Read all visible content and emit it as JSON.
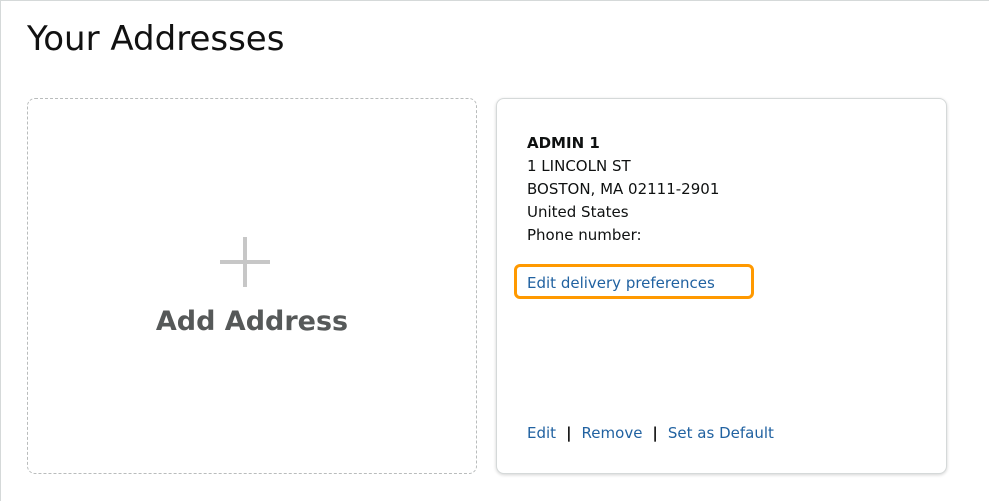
{
  "page": {
    "title": "Your Addresses"
  },
  "add_card": {
    "label": "Add Address",
    "icon": "plus-icon"
  },
  "address": {
    "name": "ADMIN 1",
    "street": "1 LINCOLN ST",
    "city_state_zip": "BOSTON, MA 02111-2901",
    "country": "United States",
    "phone_label": "Phone number:",
    "delivery_preferences_link": "Edit delivery preferences",
    "actions": {
      "edit": "Edit",
      "remove": "Remove",
      "set_default": "Set as Default",
      "separator": "|"
    }
  },
  "colors": {
    "link": "#2162a1",
    "highlight": "#ff9900",
    "card_border": "#d5d9d9",
    "dashed_border": "#b9bcbc",
    "muted_text": "#565959"
  }
}
